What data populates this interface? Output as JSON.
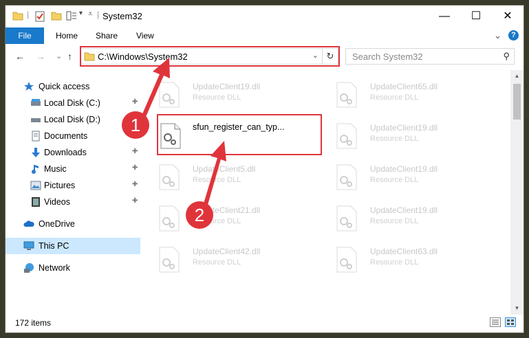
{
  "window": {
    "title": "System32",
    "minimize_glyph": "—",
    "maximize_glyph": "☐",
    "close_glyph": "✕"
  },
  "ribbon": {
    "file_label": "File",
    "tabs": [
      "Home",
      "Share",
      "View"
    ],
    "expand_glyph": "⌄",
    "help_glyph": "?"
  },
  "navigation": {
    "back_glyph": "←",
    "forward_glyph": "→",
    "recent_glyph": "⌄",
    "up_glyph": "↑",
    "address": "C:\\Windows\\System32",
    "address_dropdown": "⌄",
    "refresh_glyph": "↻",
    "search_placeholder": "Search System32",
    "search_glyph": "⚲"
  },
  "sidebar": {
    "items": [
      {
        "label": "Quick access",
        "icon": "star-icon",
        "pinned": false
      },
      {
        "label": "Local Disk (C:)",
        "icon": "drive-icon",
        "pinned": true
      },
      {
        "label": "Local Disk (D:)",
        "icon": "drive-icon",
        "pinned": false
      },
      {
        "label": "Documents",
        "icon": "documents-icon",
        "pinned": true
      },
      {
        "label": "Downloads",
        "icon": "download-icon",
        "pinned": true
      },
      {
        "label": "Music",
        "icon": "music-icon",
        "pinned": true
      },
      {
        "label": "Pictures",
        "icon": "pictures-icon",
        "pinned": true
      },
      {
        "label": "Videos",
        "icon": "videos-icon",
        "pinned": true
      },
      {
        "label": "OneDrive",
        "icon": "cloud-icon",
        "pinned": false
      },
      {
        "label": "This PC",
        "icon": "computer-icon",
        "pinned": false,
        "selected": true
      },
      {
        "label": "Network",
        "icon": "network-icon",
        "pinned": false
      }
    ],
    "pin_glyph": "📌"
  },
  "files": [
    {
      "name": "UpdateClient19.dll",
      "type": "Resource DLL"
    },
    {
      "name": "UpdateClient65.dll",
      "type": "Resource DLL"
    },
    {
      "name": "sfun_register_can_typ...",
      "type": "",
      "active": true
    },
    {
      "name": "UpdateClient19.dll",
      "type": "Resource DLL"
    },
    {
      "name": "UpdateClient5.dll",
      "type": "Resource DLL"
    },
    {
      "name": "UpdateClient19.dll",
      "type": "Resource DLL"
    },
    {
      "name": "UpdateClient21.dll",
      "type": "Resource DLL"
    },
    {
      "name": "UpdateClient19.dll",
      "type": "Resource DLL"
    },
    {
      "name": "UpdateClient42.dll",
      "type": "Resource DLL"
    },
    {
      "name": "UpdateClient63.dll",
      "type": "Resource DLL"
    }
  ],
  "status": {
    "item_count": "172 items"
  },
  "annotations": {
    "step1": "1",
    "step2": "2",
    "color": "#e0343b"
  }
}
